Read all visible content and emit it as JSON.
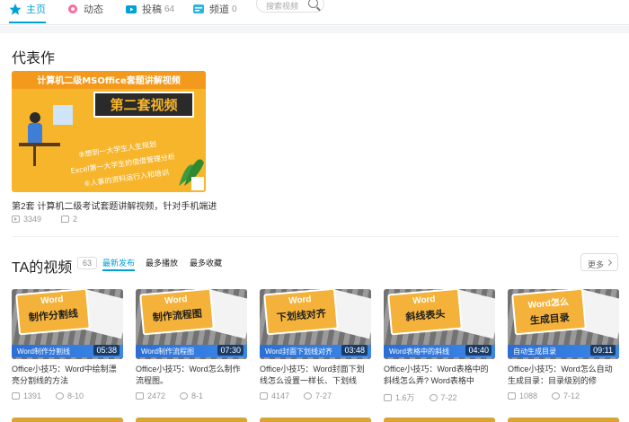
{
  "nav": {
    "items": [
      {
        "label": "主页",
        "count": ""
      },
      {
        "label": "动态",
        "count": ""
      },
      {
        "label": "投稿",
        "count": "64"
      },
      {
        "label": "频道",
        "count": "0"
      }
    ],
    "search_placeholder": "搜索视频"
  },
  "featured": {
    "section_title": "代表作",
    "thumb": {
      "top_text": "计算机二级MSOffice套题讲解视频",
      "main_text": "第二套视频",
      "line1": "⑧想到一大学生人生规划",
      "line2": "Excel第一大学生的借借管理分析",
      "line3": "⑥人事的资料运行入和培训"
    },
    "title": "第2套 计算机二级考试套题讲解视频，针对手机端进",
    "views": "3349",
    "comments": "2"
  },
  "videos_section": {
    "title": "TA的视频",
    "count": "63",
    "tabs": [
      "最新发布",
      "最多播放",
      "最多收藏"
    ],
    "more_label": "更多"
  },
  "videos": [
    {
      "badge_top": "Word",
      "badge_main": "制作分割线",
      "ribbon": "Word制作分割线",
      "duration": "05:38",
      "title": "Office小技巧：Word中绘制漂亮分割线的方法",
      "views": "1391",
      "date": "8-10"
    },
    {
      "badge_top": "Word",
      "badge_main": "制作流程图",
      "ribbon": "Word制作流程图",
      "duration": "07:30",
      "title": "Office小技巧：Word怎么制作流程图。",
      "views": "2472",
      "date": "8-1"
    },
    {
      "badge_top": "Word",
      "badge_main": "下划线对齐",
      "ribbon": "Word封面下划线对齐",
      "duration": "03:48",
      "title": "Office小技巧：Word封面下划线怎么设置一样长、下划线",
      "views": "4147",
      "date": "7-27"
    },
    {
      "badge_top": "Word",
      "badge_main": "斜线表头",
      "ribbon": "Word表格中的斜线",
      "duration": "04:40",
      "title": "Office小技巧：Word表格中的斜线怎么弄? Word表格中",
      "views": "1.6万",
      "date": "7-22"
    },
    {
      "badge_top": "Word怎么",
      "badge_main": "生成目录",
      "ribbon": "自动生成目录",
      "duration": "09:11",
      "title": "Office小技巧：Word怎么自动生成目录：目录级别的修",
      "views": "1088",
      "date": "7-12"
    }
  ],
  "colors": {
    "accent": "#00a1d6",
    "orange": "#f7b52b"
  }
}
